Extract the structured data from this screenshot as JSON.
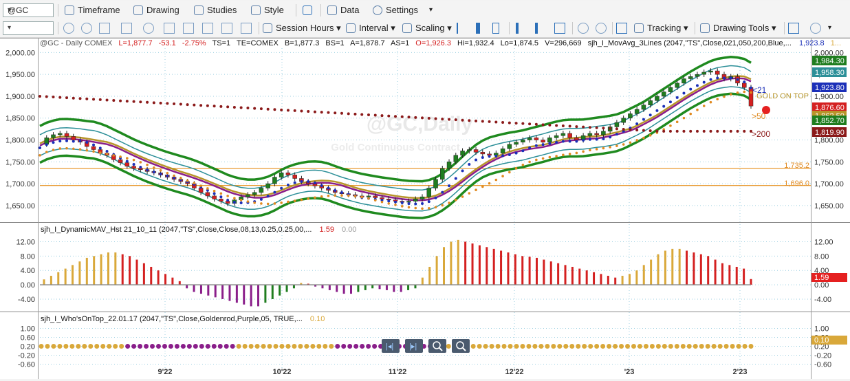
{
  "toolbar1": {
    "symbol": "@GC",
    "timeframe": "Timeframe",
    "drawing": "Drawing",
    "studies": "Studies",
    "style": "Style",
    "data": "Data",
    "settings": "Settings"
  },
  "toolbar2": {
    "session_hours": "Session Hours",
    "interval": "Interval",
    "scaling": "Scaling",
    "tracking": "Tracking",
    "drawing_tools": "Drawing Tools"
  },
  "watermark": {
    "title": "@GC,Daily",
    "subtitle": "Gold Continuous Contract"
  },
  "header": {
    "symbol_info": "@GC - Daily  COMEX",
    "last": "L=1,877.7",
    "change": "-53.1",
    "pct": "-2.75%",
    "ts": "TS=1",
    "te": "TE=COMEX",
    "bid": "B=1,877.3",
    "bs": "BS=1",
    "ask": "A=1,878.7",
    "as": "AS=1",
    "open": "O=1,926.3",
    "high": "Hi=1,932.4",
    "low": "Lo=1,874.5",
    "volume": "V=296,669",
    "study": "sjh_I_MovAvg_3Lines (2047,\"TS\",Close,021,050,200,Blue,...",
    "study_value": "1,923.8",
    "study_value2": "1..."
  },
  "panel2": {
    "label": "sjh_I_DynamicMAV_Hst 21_10_11 (2047,\"TS\",Close,Close,08,13,0.25,0.25,00,...",
    "v1": "1.59",
    "v2": "0.00",
    "badge": "1.59"
  },
  "panel3": {
    "label": "sjh_I_Who'sOnTop_22.01.17 (2047,\"TS\",Close,Goldenrod,Purple,05, TRUE,...",
    "v1": "0.10",
    "badge": "0.10"
  },
  "annotations": {
    "ma21": "<21",
    "ma50": ">50",
    "ma200": ">200",
    "gold_on_top": "GOLD ON TOP",
    "h1": "1,735.2",
    "h2": "1,696.0"
  },
  "price_badges": [
    {
      "text": "1,984.30",
      "color": "#1f7d1f"
    },
    {
      "text": "1,958.30",
      "color": "#2c8f98"
    },
    {
      "text": "1,923.80",
      "color": "#1b2fb8"
    },
    {
      "text": "1,876.60",
      "color": "#d42020"
    },
    {
      "text": "1,862.50",
      "color": "#b8952a"
    },
    {
      "text": "1,852.70",
      "color": "#1f7d1f"
    },
    {
      "text": "1,819.90",
      "color": "#8b1a1a"
    }
  ],
  "colors": {
    "up": "#1f7d1f",
    "down": "#d42020",
    "ma21": "#1b2fb8",
    "ma50": "#e08a20",
    "ma200": "#8b1a1a",
    "band": "#1f8a1f",
    "inner_band": "#2c8f98",
    "gold": "#d9a83a",
    "purple": "#8a1e8a",
    "hline": "#e89a30"
  },
  "chart_data": [
    {
      "type": "candlestick",
      "title": "@GC - Daily COMEX",
      "ylim": [
        1620,
        2010
      ],
      "yticks": [
        1650,
        1700,
        1750,
        1800,
        1850,
        1900,
        1950,
        2000
      ],
      "ytick_labels": [
        "1,650.00",
        "1,700.00",
        "1,750.00",
        "1,800.00",
        "1,850.00",
        "1,900.00",
        "1,950.00",
        "2,000.00"
      ],
      "xtick_labels": [
        "9'22",
        "10'22",
        "11'22",
        "12'22",
        "'23",
        "2'23"
      ],
      "close_path": [
        1790,
        1805,
        1812,
        1815,
        1808,
        1800,
        1795,
        1785,
        1778,
        1770,
        1765,
        1755,
        1748,
        1740,
        1735,
        1732,
        1728,
        1725,
        1720,
        1715,
        1710,
        1705,
        1700,
        1690,
        1680,
        1672,
        1665,
        1660,
        1655,
        1663,
        1670,
        1675,
        1680,
        1690,
        1700,
        1715,
        1725,
        1720,
        1712,
        1705,
        1700,
        1695,
        1690,
        1685,
        1680,
        1677,
        1675,
        1672,
        1670,
        1672,
        1668,
        1665,
        1663,
        1660,
        1658,
        1660,
        1665,
        1670,
        1690,
        1710,
        1735,
        1750,
        1765,
        1775,
        1778,
        1772,
        1768,
        1765,
        1770,
        1780,
        1790,
        1795,
        1800,
        1805,
        1800,
        1795,
        1805,
        1810,
        1815,
        1805,
        1800,
        1810,
        1815,
        1812,
        1820,
        1830,
        1840,
        1850,
        1860,
        1870,
        1880,
        1890,
        1900,
        1910,
        1920,
        1930,
        1940,
        1945,
        1950,
        1955,
        1958,
        1950,
        1940,
        1945,
        1930,
        1920,
        1877.7
      ],
      "horizontal_lines": [
        1735.2,
        1696.0
      ],
      "ma_last": {
        "ma21": 1923.8,
        "ma50": 1862.5,
        "ma200": 1819.9
      }
    },
    {
      "type": "bar",
      "title": "sjh_I_DynamicMAV_Hst 21_10_11",
      "ylim": [
        -6.5,
        14
      ],
      "yticks": [
        12,
        8,
        4,
        0,
        -4
      ],
      "ytick_labels": [
        "12.00",
        "8.00",
        "4.00",
        "0.00",
        "-4.00"
      ],
      "values": [
        1.5,
        2.5,
        3.5,
        4.5,
        5.5,
        6.5,
        7.5,
        8.0,
        8.5,
        9.0,
        9.0,
        8.5,
        8.0,
        7.0,
        6.0,
        5.0,
        4.0,
        3.0,
        2.0,
        1.0,
        -1.0,
        -2.0,
        -2.5,
        -3.0,
        -3.5,
        -4.0,
        -4.5,
        -5.0,
        -5.5,
        -6.0,
        -6.0,
        -5.0,
        -4.0,
        -3.0,
        -2.0,
        -1.0,
        0.5,
        0.3,
        -0.5,
        -1.0,
        -1.5,
        -2.0,
        -2.5,
        -2.5,
        -2.0,
        -1.5,
        -1.0,
        -1.2,
        -1.5,
        -2.0,
        -2.0,
        -1.5,
        -1.0,
        2.0,
        5.0,
        8.0,
        10.5,
        12.0,
        12.5,
        12.0,
        11.5,
        11.0,
        10.5,
        10.0,
        9.5,
        9.0,
        8.5,
        8.0,
        7.8,
        7.5,
        7.0,
        6.5,
        6.0,
        5.5,
        5.0,
        4.5,
        4.0,
        3.5,
        3.0,
        2.5,
        2.0,
        2.5,
        3.0,
        4.0,
        5.5,
        7.0,
        8.5,
        9.5,
        10.0,
        10.0,
        9.5,
        9.0,
        8.5,
        8.0,
        7.0,
        6.0,
        5.5,
        5.0,
        4.5,
        1.59
      ]
    },
    {
      "type": "scatter",
      "title": "sjh_I_Who'sOnTop_22.01.17",
      "ylim": [
        -0.8,
        1.2
      ],
      "yticks": [
        1.0,
        0.6,
        0.2,
        -0.2,
        -0.6
      ],
      "ytick_labels": [
        "1.00",
        "0.60",
        "0.20",
        "-0.20",
        "-0.60"
      ],
      "value": 0.1
    }
  ]
}
